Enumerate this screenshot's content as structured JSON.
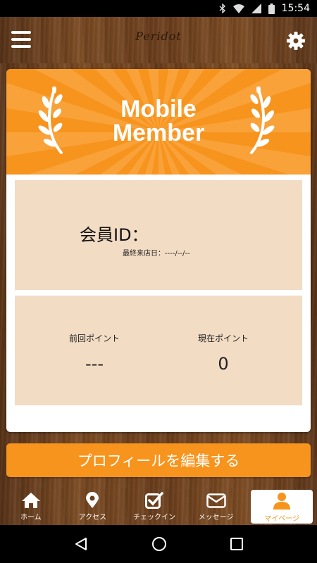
{
  "status_bar": {
    "time": "15:54",
    "icons": [
      "bluetooth-icon",
      "wifi-icon",
      "signal-icon",
      "battery-icon"
    ]
  },
  "header": {
    "logo_text": "Peridot",
    "menu_icon": "hamburger-menu-icon",
    "settings_icon": "gear-icon"
  },
  "banner": {
    "title_line1": "Mobile",
    "title_line2": "Member",
    "decoration_icon": "laurel-icon"
  },
  "member": {
    "id_label": "会員ID：",
    "last_visit": "最終来店日：----/--/--"
  },
  "points": {
    "previous_label": "前回ポイント",
    "previous_value": "---",
    "current_label": "現在ポイント",
    "current_value": "0"
  },
  "edit_profile_label": "プロフィールを編集する",
  "tabs": [
    {
      "label": "ホーム",
      "icon": "home-icon",
      "active": false
    },
    {
      "label": "アクセス",
      "icon": "map-pin-icon",
      "active": false
    },
    {
      "label": "チェックイン",
      "icon": "checkbox-icon",
      "active": false
    },
    {
      "label": "メッセージ",
      "icon": "envelope-icon",
      "active": false
    },
    {
      "label": "マイページ",
      "icon": "person-icon",
      "active": true
    }
  ],
  "colors": {
    "accent": "#f7941d",
    "panel": "#f3dcc4",
    "wood": "#6b3e1c"
  }
}
